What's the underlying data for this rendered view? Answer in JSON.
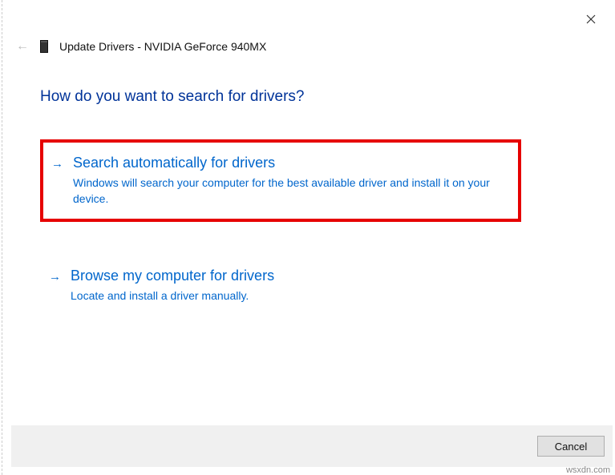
{
  "header": {
    "title": "Update Drivers - NVIDIA GeForce 940MX"
  },
  "question": "How do you want to search for drivers?",
  "options": [
    {
      "title": "Search automatically for drivers",
      "description": "Windows will search your computer for the best available driver and install it on your device."
    },
    {
      "title": "Browse my computer for drivers",
      "description": "Locate and install a driver manually."
    }
  ],
  "buttons": {
    "cancel": "Cancel"
  },
  "watermark": "wsxdn.com"
}
